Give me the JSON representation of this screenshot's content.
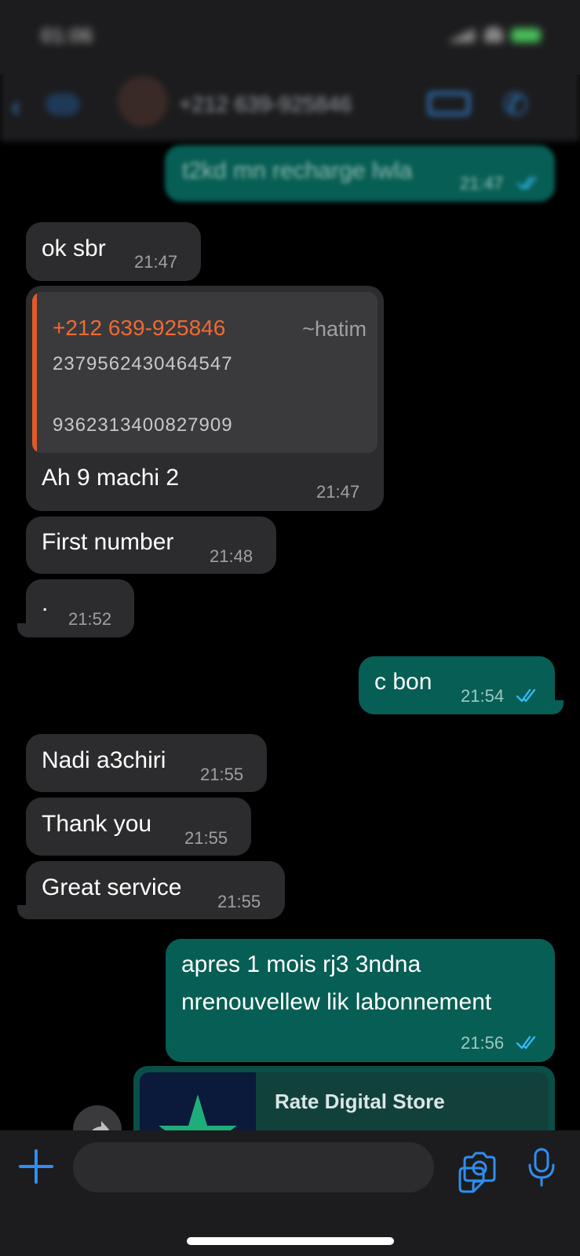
{
  "status_bar": {
    "time": "01:06"
  },
  "header": {
    "contact": "+212 639-925846"
  },
  "messages": [
    {
      "dir": "out",
      "text": "t2kd mn recharge lwla",
      "time": "21:47"
    },
    {
      "dir": "in",
      "text": "ok sbr",
      "time": "21:47"
    },
    {
      "dir": "in",
      "quote": {
        "name": "+212 639-925846",
        "handle": "~hatim",
        "line1": "2379562430464547",
        "line2": "9362313400827909"
      },
      "text": "Ah 9 machi 2",
      "time": "21:47"
    },
    {
      "dir": "in",
      "text": "First number",
      "time": "21:48"
    },
    {
      "dir": "in",
      "text": ".",
      "time": "21:52"
    },
    {
      "dir": "out",
      "text": "c bon",
      "time": "21:54"
    },
    {
      "dir": "in",
      "text": "Nadi a3chiri",
      "time": "21:55"
    },
    {
      "dir": "in",
      "text": "Thank you",
      "time": "21:55"
    },
    {
      "dir": "in",
      "text": "Great service",
      "time": "21:55"
    },
    {
      "dir": "out",
      "line1": "apres 1 mois rj3 3ndna",
      "line2": "nrenouvellew lik labonnement",
      "time": "21:56"
    }
  ],
  "link_preview": {
    "title": "Rate Digital Store"
  },
  "icons": {
    "plus": "plus-icon",
    "sticker": "sticker-icon",
    "camera": "camera-icon",
    "mic": "microphone-icon",
    "read_receipt": "double-check-icon"
  },
  "colors": {
    "incoming_bubble": "#2c2c2e",
    "outgoing_bubble": "#075e54",
    "accent": "#2f8ef0",
    "quote_accent": "#f06a33"
  }
}
